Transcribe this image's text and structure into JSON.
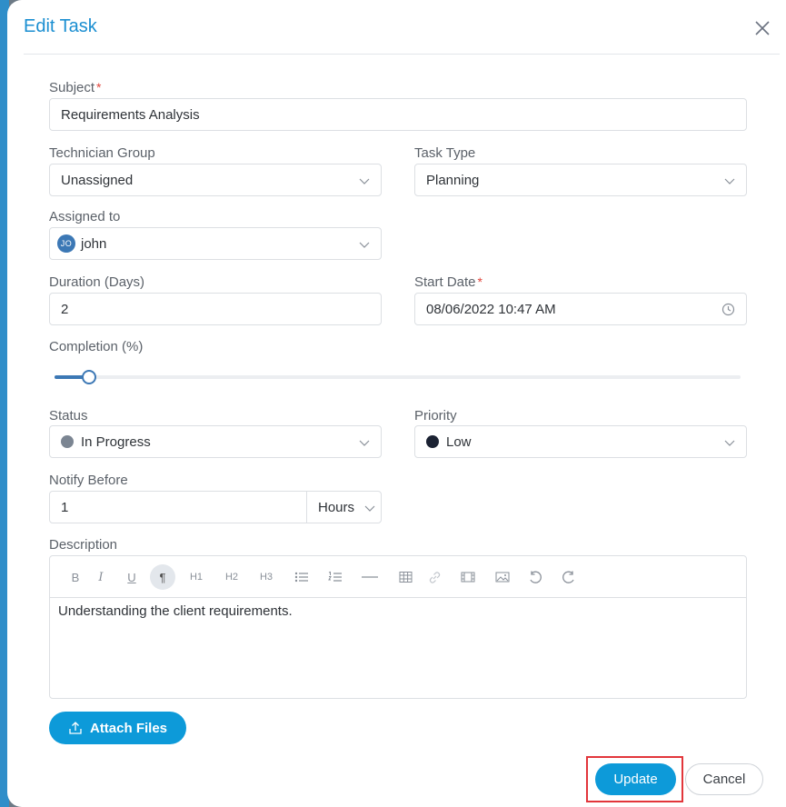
{
  "dialog": {
    "title": "Edit Task",
    "close_icon": "close-icon"
  },
  "form": {
    "subject": {
      "label": "Subject",
      "required_mark": "*",
      "value": "Requirements Analysis"
    },
    "technician_group": {
      "label": "Technician Group",
      "value": "Unassigned"
    },
    "task_type": {
      "label": "Task Type",
      "value": "Planning"
    },
    "assigned_to": {
      "label": "Assigned to",
      "avatar_initials": "JO",
      "value": "john"
    },
    "duration": {
      "label": "Duration (Days)",
      "value": "2"
    },
    "start_date": {
      "label": "Start Date",
      "required_mark": "*",
      "value": "08/06/2022 10:47 AM"
    },
    "completion": {
      "label": "Completion (%)",
      "value_percent": 5
    },
    "status": {
      "label": "Status",
      "value": "In Progress",
      "color": "#7b8592"
    },
    "priority": {
      "label": "Priority",
      "value": "Low",
      "color": "#1b2233"
    },
    "notify_before": {
      "label": "Notify Before",
      "value": "1",
      "unit": "Hours"
    },
    "description": {
      "label": "Description",
      "toolbar": {
        "bold": "B",
        "italic": "I",
        "underline": "U",
        "paragraph": "¶",
        "h1": "H1",
        "h2": "H2",
        "h3": "H3"
      },
      "text": "Understanding the client requirements."
    }
  },
  "actions": {
    "attach_label": "Attach Files",
    "update_label": "Update",
    "cancel_label": "Cancel"
  },
  "colors": {
    "accent": "#0d9ad9",
    "title": "#1a8ed1",
    "slider": "#3c78b5",
    "highlight": "#e2363b"
  }
}
